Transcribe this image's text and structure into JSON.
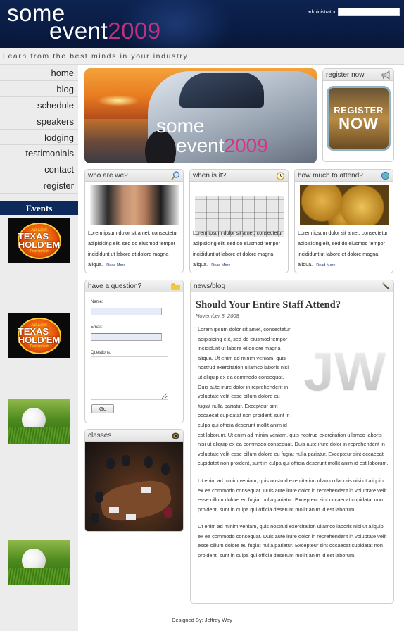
{
  "header": {
    "logo_line1": "some",
    "logo_line2": "event",
    "logo_year": "2009",
    "admin_label": "administrator:"
  },
  "tagline": "Learn from the best minds in your industry",
  "nav": [
    {
      "label": "home"
    },
    {
      "label": "blog"
    },
    {
      "label": "schedule"
    },
    {
      "label": "speakers"
    },
    {
      "label": "lodging"
    },
    {
      "label": "testimonials"
    },
    {
      "label": "contact"
    },
    {
      "label": "register"
    }
  ],
  "events": {
    "heading": "Events",
    "thumbs": [
      {
        "type": "holdem",
        "top_text": "No-Limit",
        "main_text": "TEXAS HOLD'EM",
        "bottom_text": "Tournament"
      },
      {
        "type": "golf"
      },
      {
        "type": "holdem",
        "top_text": "No-Limit",
        "main_text": "TEXAS HOLD'EM",
        "bottom_text": "Tournament"
      },
      {
        "type": "golf"
      }
    ]
  },
  "hero": {
    "line1": "some",
    "line2": "event",
    "year": "2009"
  },
  "register_box": {
    "title": "register now",
    "button_line1": "REGISTER",
    "button_line2": "NOW"
  },
  "info_boxes": [
    {
      "title": "who are we?",
      "icon": "magnifier-icon",
      "text": "Lorem ipsum dolor sit amet, consectetur adipisicing elit, sed do eiusmod tempor incididunt ut labore et dolore magna aliqua.",
      "more": "Read More"
    },
    {
      "title": "when is it?",
      "icon": "clock-icon",
      "text": "Lorem ipsum dolor sit amet, consectetur adipisicing elit, sed do eiusmod tempor incididunt ut labore et dolore magna aliqua.",
      "more": "Read More"
    },
    {
      "title": "how much to attend?",
      "icon": "globe-icon",
      "text": "Lorem ipsum dolor sit amet, consectetur adipisicing elit, sed do eiusmod tempor incididunt ut labore et dolore magna aliqua.",
      "more": "Read More"
    }
  ],
  "question_box": {
    "title": "have a question?",
    "name_label": "Name:",
    "email_label": "Email:",
    "questions_label": "Questions:",
    "submit_label": "Go"
  },
  "classes_box": {
    "title": "classes"
  },
  "news": {
    "title": "news/blog",
    "post_title": "Should Your Entire Staff Attend?",
    "post_date": "November 3, 2008",
    "logo_text": "JW",
    "paragraphs": [
      "Lorem ipsum dolor sit amet, consectetur adipisicing elit, sed do eiusmod tempor incididunt ut labore et dolore magna aliqua. Ut enim ad minim veniam, quis nostrud exercitation ullamco laboris nisi ut aliquip ex ea commodo consequat. Duis aute irure dolor in reprehenderit in voluptate velit esse cillum dolore eu fugiat nulla pariatur. Excepteur sint occaecat cupidatat non proident, sunt in culpa qui officia deserunt mollit anim id est laborum. Ut enim ad minim veniam, quis nostrud exercitation ullamco laboris nisi ut aliquip ex ea commodo consequat. Duis aute irure dolor in reprehenderit in voluptate velit esse cillum dolore eu fugiat nulla pariatur. Excepteur sint occaecat cupidatat non proident, sunt in culpa qui officia deserunt mollit anim id est laborum.",
      "Ut enim ad minim veniam, quis nostrud exercitation ullamco laboris nisi ut aliquip ex ea commodo consequat. Duis aute irure dolor in reprehenderit in voluptate velit esse cillum dolore eu fugiat nulla pariatur. Excepteur sint occaecat cupidatat non proident, sunt in culpa qui officia deserunt mollit anim id est laborum.",
      "Ut enim ad minim veniam, quis nostrud exercitation ullamco laboris nisi ut aliquip ex ea commodo consequat. Duis aute irure dolor in reprehenderit in voluptate velit esse cillum dolore eu fugiat nulla pariatur. Excepteur sint occaecat cupidatat non proident, sunt in culpa qui officia deserunt mollit anim id est laborum."
    ]
  },
  "footer": "Designed By: Jeffrey Way",
  "colors": {
    "header_bg": "#0a1c44",
    "accent_magenta": "#c0317f",
    "events_head_bg": "#0e2a5a",
    "link_blue": "#1b3a78"
  }
}
